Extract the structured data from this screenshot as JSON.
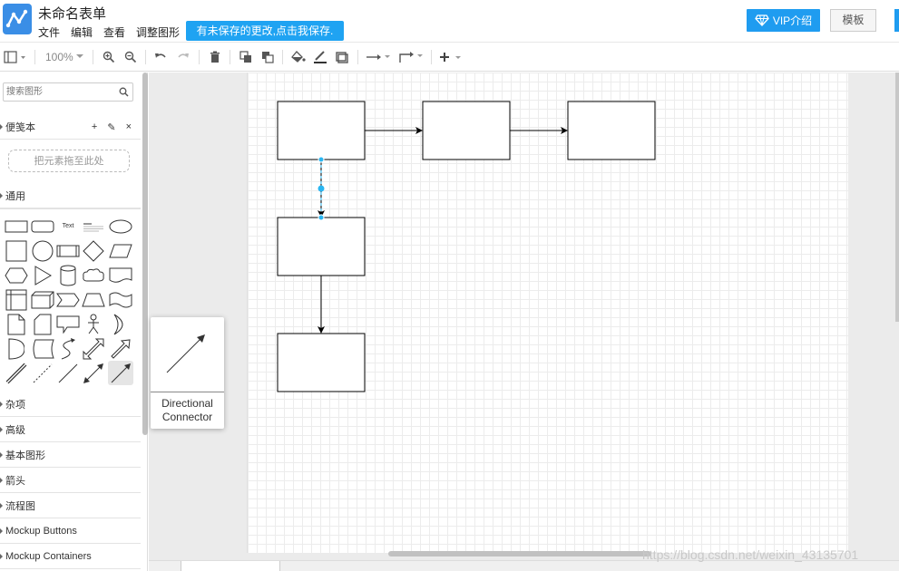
{
  "header": {
    "title": "未命名表单",
    "menu": [
      "文件",
      "编辑",
      "查看",
      "调整图形"
    ],
    "unsaved_notice": "有未保存的更改,点击我保存.",
    "vip_label": "VIP介绍",
    "template_label": "模板"
  },
  "toolbar": {
    "zoom": "100%"
  },
  "sidebar": {
    "search_placeholder": "搜索图形",
    "scratchpad": {
      "label": "便笺本",
      "drop_hint": "把元素拖至此处"
    },
    "general": {
      "label": "通用"
    },
    "text_shape": "Text",
    "sections": [
      "杂项",
      "高级",
      "基本图形",
      "箭头",
      "流程图",
      "Mockup Buttons",
      "Mockup Containers"
    ]
  },
  "tooltip": {
    "line1": "Directional",
    "line2": "Connector"
  },
  "watermark": "https://blog.csdn.net/weixin_43135701",
  "colors": {
    "accent": "#1fa3f2",
    "selection": "#29b6f2"
  }
}
